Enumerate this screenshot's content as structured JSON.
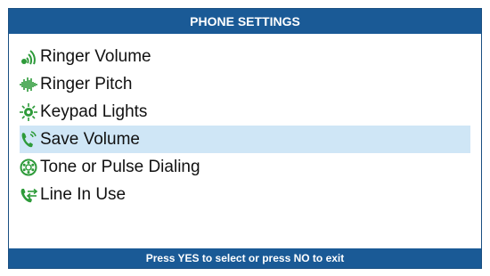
{
  "header": {
    "title": "PHONE SETTINGS"
  },
  "menu": {
    "items": [
      {
        "label": "Ringer Volume",
        "icon": "ringer-volume-icon",
        "selected": false
      },
      {
        "label": "Ringer Pitch",
        "icon": "ringer-pitch-icon",
        "selected": false
      },
      {
        "label": "Keypad Lights",
        "icon": "keypad-lights-icon",
        "selected": false
      },
      {
        "label": "Save Volume",
        "icon": "save-volume-icon",
        "selected": true
      },
      {
        "label": "Tone or Pulse Dialing",
        "icon": "tone-pulse-dialing-icon",
        "selected": false
      },
      {
        "label": "Line In Use",
        "icon": "line-in-use-icon",
        "selected": false
      }
    ]
  },
  "footer": {
    "hint": "Press YES to select or press NO to exit"
  },
  "colors": {
    "bar": "#1a5a96",
    "selection": "#cfe6f6",
    "icon_green": "#2e9b3a"
  }
}
